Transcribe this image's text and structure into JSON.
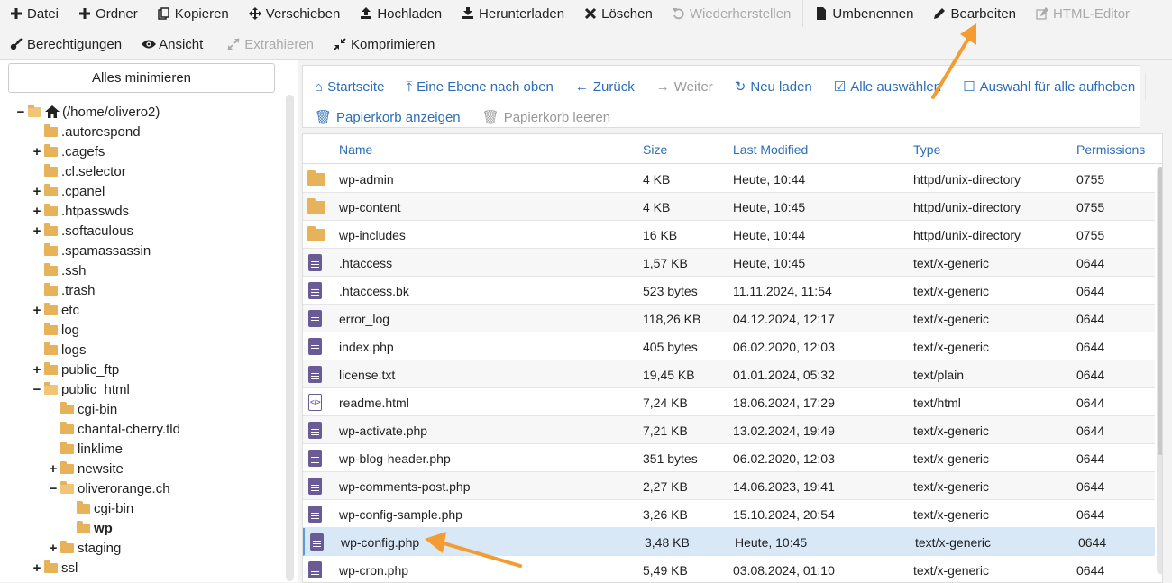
{
  "toolbar": {
    "row1": [
      {
        "label": "Datei",
        "icon": "plus-icon",
        "disabled": false
      },
      {
        "label": "Ordner",
        "icon": "plus-icon",
        "disabled": false
      },
      {
        "label": "Kopieren",
        "icon": "copy-icon",
        "disabled": false
      },
      {
        "label": "Verschieben",
        "icon": "move-icon",
        "disabled": false
      },
      {
        "label": "Hochladen",
        "icon": "upload-icon",
        "disabled": false
      },
      {
        "label": "Herunterladen",
        "icon": "download-icon",
        "disabled": false
      },
      {
        "label": "Löschen",
        "icon": "close-icon",
        "disabled": false
      },
      {
        "label": "Wiederherstellen",
        "icon": "undo-icon",
        "disabled": true
      },
      {
        "label": "Umbenennen",
        "icon": "file-icon",
        "disabled": false
      },
      {
        "label": "Bearbeiten",
        "icon": "pencil-icon",
        "disabled": false
      },
      {
        "label": "HTML-Editor",
        "icon": "edit-icon",
        "disabled": true
      }
    ],
    "row2": [
      {
        "label": "Berechtigungen",
        "icon": "key-icon",
        "disabled": false
      },
      {
        "label": "Ansicht",
        "icon": "eye-icon",
        "disabled": false
      },
      {
        "label": "Extrahieren",
        "icon": "expand-icon",
        "disabled": true
      },
      {
        "label": "Komprimieren",
        "icon": "compress-icon",
        "disabled": false
      }
    ]
  },
  "sidebar": {
    "collapse_label": "Alles minimieren",
    "tree": [
      {
        "label": "(/home/olivero2)",
        "toggle": "−",
        "level": 0,
        "type": "home"
      },
      {
        "label": ".autorespond",
        "toggle": "",
        "level": 1,
        "type": "folder"
      },
      {
        "label": ".cagefs",
        "toggle": "+",
        "level": 1,
        "type": "folder"
      },
      {
        "label": ".cl.selector",
        "toggle": "",
        "level": 1,
        "type": "folder"
      },
      {
        "label": ".cpanel",
        "toggle": "+",
        "level": 1,
        "type": "folder"
      },
      {
        "label": ".htpasswds",
        "toggle": "+",
        "level": 1,
        "type": "folder"
      },
      {
        "label": ".softaculous",
        "toggle": "+",
        "level": 1,
        "type": "folder"
      },
      {
        "label": ".spamassassin",
        "toggle": "",
        "level": 1,
        "type": "folder"
      },
      {
        "label": ".ssh",
        "toggle": "",
        "level": 1,
        "type": "folder"
      },
      {
        "label": ".trash",
        "toggle": "",
        "level": 1,
        "type": "folder"
      },
      {
        "label": "etc",
        "toggle": "+",
        "level": 1,
        "type": "folder"
      },
      {
        "label": "log",
        "toggle": "",
        "level": 1,
        "type": "folder"
      },
      {
        "label": "logs",
        "toggle": "",
        "level": 1,
        "type": "folder"
      },
      {
        "label": "public_ftp",
        "toggle": "+",
        "level": 1,
        "type": "folder"
      },
      {
        "label": "public_html",
        "toggle": "−",
        "level": 1,
        "type": "folder-open"
      },
      {
        "label": "cgi-bin",
        "toggle": "",
        "level": 2,
        "type": "folder"
      },
      {
        "label": "chantal-cherry.tld",
        "toggle": "",
        "level": 2,
        "type": "folder"
      },
      {
        "label": "linklime",
        "toggle": "",
        "level": 2,
        "type": "folder"
      },
      {
        "label": "newsite",
        "toggle": "+",
        "level": 2,
        "type": "folder"
      },
      {
        "label": "oliverorange.ch",
        "toggle": "−",
        "level": 2,
        "type": "folder-open"
      },
      {
        "label": "cgi-bin",
        "toggle": "",
        "level": 3,
        "type": "folder"
      },
      {
        "label": "wp",
        "toggle": "",
        "level": 3,
        "type": "folder",
        "bold": true
      },
      {
        "label": "staging",
        "toggle": "+",
        "level": 2,
        "type": "folder"
      },
      {
        "label": "ssl",
        "toggle": "+",
        "level": 1,
        "type": "folder"
      }
    ]
  },
  "nav": {
    "row1": [
      {
        "label": "Startseite",
        "icon": "⌂",
        "disabled": false
      },
      {
        "label": "Eine Ebene nach oben",
        "icon": "⤒",
        "disabled": false
      },
      {
        "label": "Zurück",
        "icon": "←",
        "disabled": false
      },
      {
        "label": "Weiter",
        "icon": "→",
        "disabled": true
      },
      {
        "label": "Neu laden",
        "icon": "↻",
        "disabled": false
      },
      {
        "label": "Alle auswählen",
        "icon": "☑",
        "disabled": false
      },
      {
        "label": "Auswahl für alle aufheben",
        "icon": "☐",
        "disabled": false
      }
    ],
    "row2": [
      {
        "label": "Papierkorb anzeigen",
        "icon": "🗑",
        "disabled": false
      },
      {
        "label": "Papierkorb leeren",
        "icon": "🗑",
        "disabled": true
      }
    ]
  },
  "table": {
    "columns": [
      "Name",
      "Size",
      "Last Modified",
      "Type",
      "Permissions"
    ],
    "rows": [
      {
        "name": "wp-admin",
        "size": "4 KB",
        "modified": "Heute, 10:44",
        "type": "httpd/unix-directory",
        "perms": "0755",
        "kind": "dir"
      },
      {
        "name": "wp-content",
        "size": "4 KB",
        "modified": "Heute, 10:45",
        "type": "httpd/unix-directory",
        "perms": "0755",
        "kind": "dir"
      },
      {
        "name": "wp-includes",
        "size": "16 KB",
        "modified": "Heute, 10:44",
        "type": "httpd/unix-directory",
        "perms": "0755",
        "kind": "dir"
      },
      {
        "name": ".htaccess",
        "size": "1,57 KB",
        "modified": "Heute, 10:45",
        "type": "text/x-generic",
        "perms": "0644",
        "kind": "file"
      },
      {
        "name": ".htaccess.bk",
        "size": "523 bytes",
        "modified": "11.11.2024, 11:54",
        "type": "text/x-generic",
        "perms": "0644",
        "kind": "file"
      },
      {
        "name": "error_log",
        "size": "118,26 KB",
        "modified": "04.12.2024, 12:17",
        "type": "text/x-generic",
        "perms": "0644",
        "kind": "file"
      },
      {
        "name": "index.php",
        "size": "405 bytes",
        "modified": "06.02.2020, 12:03",
        "type": "text/x-generic",
        "perms": "0644",
        "kind": "file"
      },
      {
        "name": "license.txt",
        "size": "19,45 KB",
        "modified": "01.01.2024, 05:32",
        "type": "text/plain",
        "perms": "0644",
        "kind": "file"
      },
      {
        "name": "readme.html",
        "size": "7,24 KB",
        "modified": "18.06.2024, 17:29",
        "type": "text/html",
        "perms": "0644",
        "kind": "html"
      },
      {
        "name": "wp-activate.php",
        "size": "7,21 KB",
        "modified": "13.02.2024, 19:49",
        "type": "text/x-generic",
        "perms": "0644",
        "kind": "file"
      },
      {
        "name": "wp-blog-header.php",
        "size": "351 bytes",
        "modified": "06.02.2020, 12:03",
        "type": "text/x-generic",
        "perms": "0644",
        "kind": "file"
      },
      {
        "name": "wp-comments-post.php",
        "size": "2,27 KB",
        "modified": "14.06.2023, 19:41",
        "type": "text/x-generic",
        "perms": "0644",
        "kind": "file"
      },
      {
        "name": "wp-config-sample.php",
        "size": "3,26 KB",
        "modified": "15.10.2024, 20:54",
        "type": "text/x-generic",
        "perms": "0644",
        "kind": "file"
      },
      {
        "name": "wp-config.php",
        "size": "3,48 KB",
        "modified": "Heute, 10:45",
        "type": "text/x-generic",
        "perms": "0644",
        "kind": "file",
        "selected": true
      },
      {
        "name": "wp-cron.php",
        "size": "5,49 KB",
        "modified": "03.08.2024, 01:10",
        "type": "text/x-generic",
        "perms": "0644",
        "kind": "file"
      }
    ]
  },
  "colors": {
    "accent": "#2d6db5",
    "folder": "#e7b35a",
    "file": "#6a5b97",
    "selected_row": "#d9e8f6",
    "annotation_arrow": "#f39c32"
  }
}
